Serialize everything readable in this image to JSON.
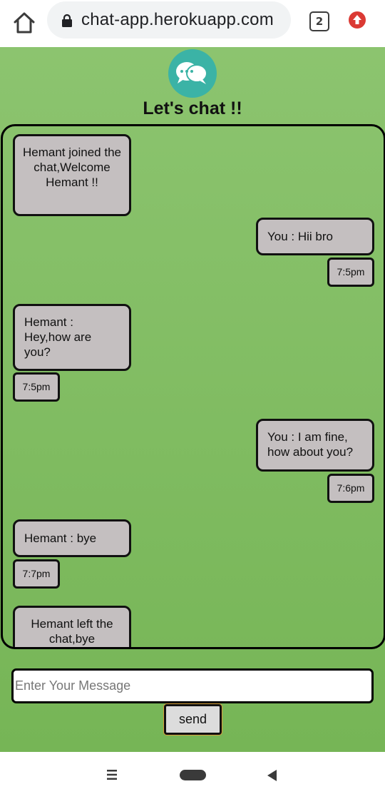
{
  "browser": {
    "url": "chat-app.herokuapp.com",
    "tab_count": "2"
  },
  "app": {
    "title": "Let's chat !!"
  },
  "messages": [
    {
      "side": "left",
      "text": "Hemant joined the chat,Welcome Hemant !!"
    },
    {
      "side": "right",
      "text": "You : Hii bro",
      "time": "7:5pm"
    },
    {
      "side": "left",
      "text": "Hemant : Hey,how are you?",
      "time": "7:5pm"
    },
    {
      "side": "right",
      "text": "You : I am fine, how about you?",
      "time": "7:6pm"
    },
    {
      "side": "left",
      "text": "Hemant : bye",
      "time": "7:7pm"
    },
    {
      "side": "left",
      "text": "Hemant left the chat,bye"
    }
  ],
  "composer": {
    "placeholder": "Enter Your Message",
    "send_label": "send"
  },
  "colors": {
    "background_green": "#7ebc5e",
    "bubble_gray": "#c4bfc0",
    "logo_teal": "#3bb3a6",
    "update_red": "#db3a34"
  },
  "icons": {
    "home": "home-icon",
    "lock": "lock-icon",
    "tabs": "tabs-icon",
    "update": "update-arrow-icon",
    "logo": "chat-bubbles-icon",
    "nav_menu": "recent-apps-icon",
    "nav_home": "home-pill-icon",
    "nav_back": "back-triangle-icon"
  }
}
